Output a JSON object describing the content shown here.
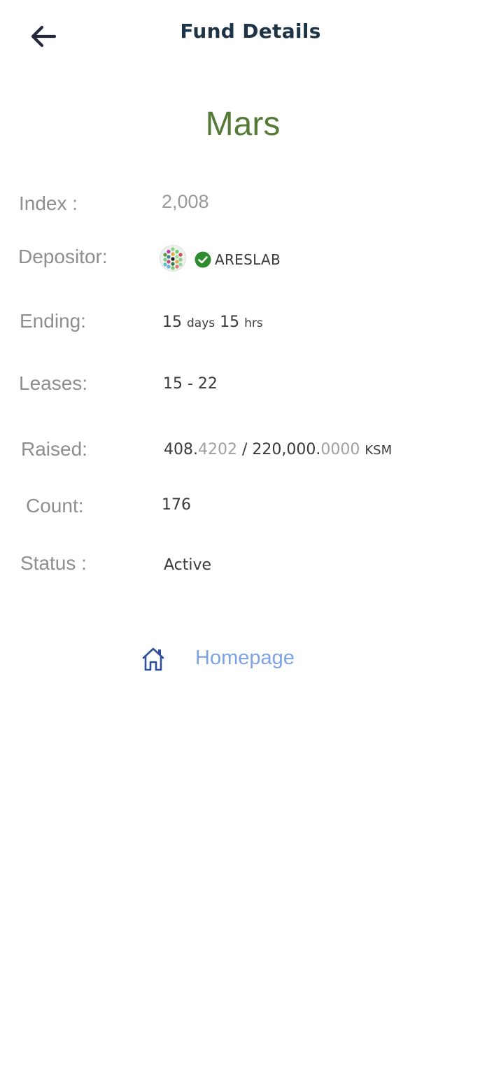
{
  "header": {
    "title": "Fund Details",
    "back_icon": "arrow-left-icon"
  },
  "fund": {
    "name": "Mars",
    "name_color": "#557a36"
  },
  "details": {
    "index": {
      "label": "Index :",
      "value": "2,008"
    },
    "depositor": {
      "label": "Depositor:",
      "avatar_icon": "identicon-avatar",
      "verified_icon": "verified-check-icon",
      "name": "ARESLAB"
    },
    "ending": {
      "label": "Ending:",
      "days_num": "15",
      "days_unit": "days",
      "hrs_num": "15",
      "hrs_unit": "hrs"
    },
    "leases": {
      "label": "Leases:",
      "value": "15 - 22"
    },
    "raised": {
      "label": "Raised:",
      "raised_int": "408.",
      "raised_dec": "4202",
      "separator": " / ",
      "cap_int": "220,000.",
      "cap_dec": "0000",
      "unit": "KSM"
    },
    "count": {
      "label": "Count:",
      "value": "176"
    },
    "status": {
      "label": "Status :",
      "value": "Active"
    }
  },
  "links": {
    "homepage": {
      "icon": "home-icon",
      "label": "Homepage",
      "color": "#7da3e3"
    }
  }
}
